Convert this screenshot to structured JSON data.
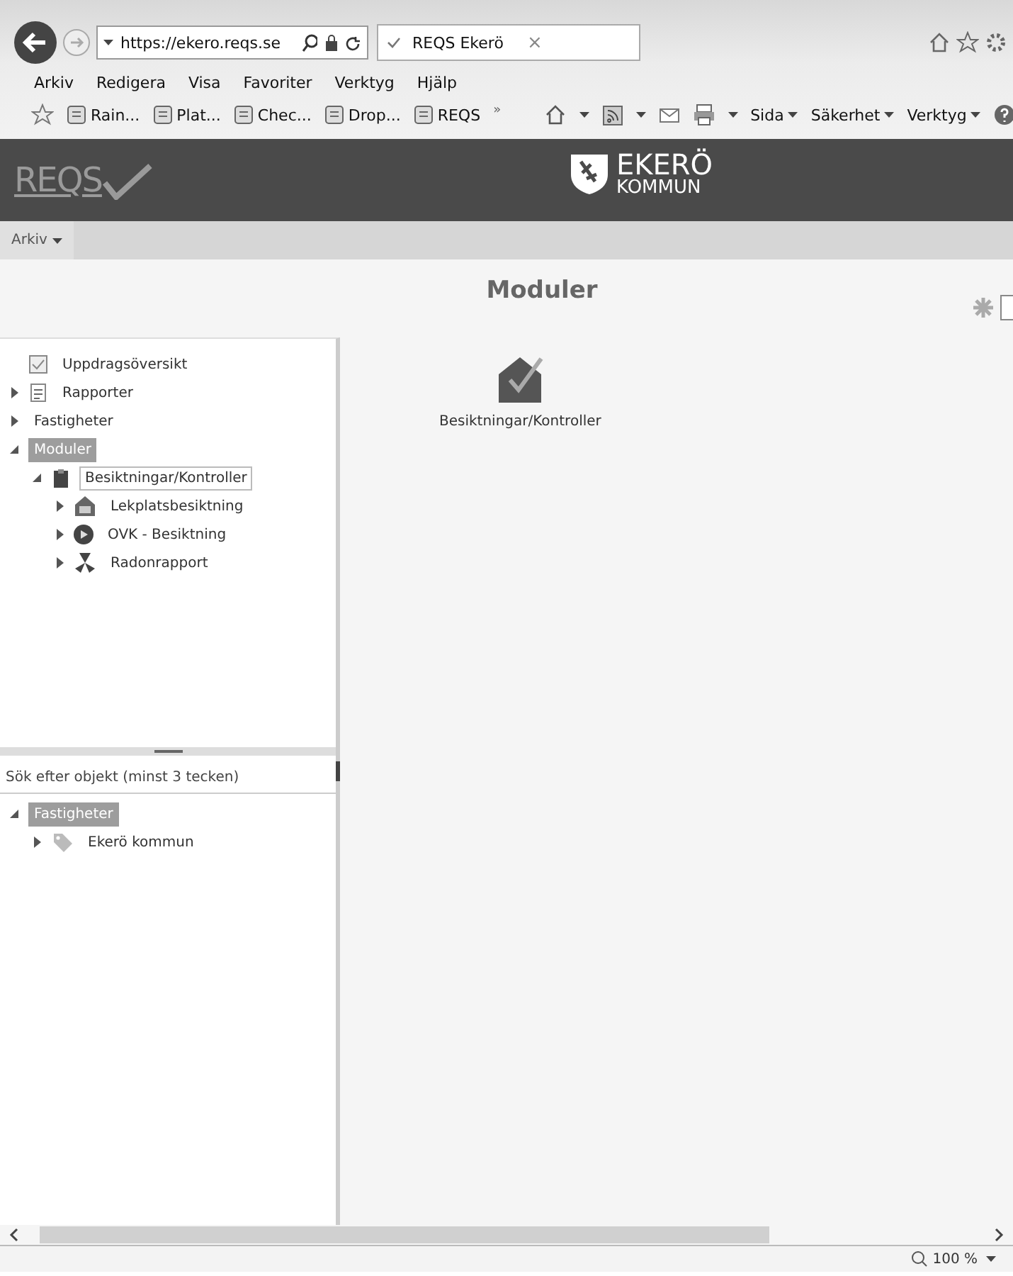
{
  "browser": {
    "address": "https://ekero.reqs.se",
    "tab": {
      "title": "REQS Ekerö",
      "close": "×"
    },
    "menu": [
      "Arkiv",
      "Redigera",
      "Visa",
      "Favoriter",
      "Verktyg",
      "Hjälp"
    ],
    "favorites": [
      "Rain...",
      "Plat...",
      "Chec...",
      "Drop...",
      "REQS"
    ],
    "more": "»",
    "tools": [
      "Sida",
      "Säkerhet",
      "Verktyg"
    ]
  },
  "header": {
    "logo": "REQS",
    "brand": "EKERÖ",
    "brand_sub": "KOMMUN"
  },
  "app_menu": [
    {
      "label": "Arkiv"
    }
  ],
  "page_title": "Moduler",
  "tree": [
    {
      "label": "Uppdragsöversikt",
      "kind": "overview",
      "selected": false
    },
    {
      "label": "Rapporter",
      "kind": "report",
      "expanded": false,
      "selected": false
    },
    {
      "label": "Fastigheter",
      "expanded": false,
      "selected": false
    },
    {
      "label": "Moduler",
      "expanded": true,
      "selected": true,
      "children": [
        {
          "label": "Besiktningar/Kontroller",
          "kind": "clipboard",
          "expanded": true,
          "selected": false,
          "focused": true,
          "children": [
            {
              "label": "Lekplatsbesiktning",
              "kind": "house",
              "expanded": false,
              "selected": false
            },
            {
              "label": "OVK - Besiktning",
              "kind": "play",
              "expanded": false,
              "selected": false
            },
            {
              "label": "Radonrapport",
              "kind": "radiation",
              "expanded": false,
              "selected": false
            }
          ]
        }
      ]
    }
  ],
  "search": {
    "placeholder": "Sök efter objekt (minst 3 tecken)"
  },
  "object_tree": [
    {
      "label": "Fastigheter",
      "expanded": true,
      "selected": true,
      "children": [
        {
          "label": "Ekerö kommun",
          "kind": "tag",
          "expanded": false,
          "selected": false
        }
      ]
    }
  ],
  "modules": [
    {
      "label": "Besiktningar/Kontroller"
    }
  ],
  "status_bar": {
    "zoom": "100 %"
  }
}
